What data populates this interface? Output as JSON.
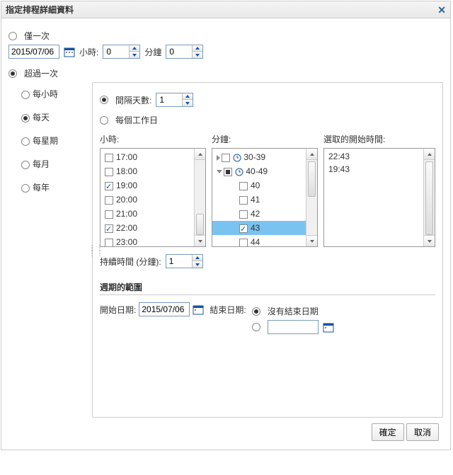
{
  "title": "指定排程詳細資料",
  "once": {
    "label": "僅一次",
    "date": "2015/07/06",
    "hour_label": "小時:",
    "hour_value": "0",
    "minute_label": "分鐘",
    "minute_value": "0"
  },
  "more_than_once": {
    "label": "超過一次",
    "options": {
      "hourly": "每小時",
      "daily": "每天",
      "weekly": "每星期",
      "monthly": "每月",
      "yearly": "每年"
    }
  },
  "interval": {
    "days_label": "間隔天數:",
    "days_value": "1",
    "workday_label": "每個工作日"
  },
  "columns": {
    "hour": "小時:",
    "minute": "分鐘:",
    "selected": "選取的開始時間:"
  },
  "hours": [
    "17:00",
    "18:00",
    "19:00",
    "20:00",
    "21:00",
    "22:00",
    "23:00"
  ],
  "hours_checked": [
    "19:00",
    "22:00"
  ],
  "minute_tree": {
    "group_30_39": "30-39",
    "group_40_49": "40-49",
    "items": [
      "40",
      "41",
      "42",
      "43",
      "44"
    ],
    "checked": [
      "43"
    ]
  },
  "selected_times": [
    "22:43",
    "19:43"
  ],
  "duration": {
    "label": "持續時間 (分鐘):",
    "value": "1"
  },
  "range": {
    "title": "週期的範圍",
    "start_label": "開始日期:",
    "start_date": "2015/07/06",
    "end_label": "結束日期:",
    "no_end_label": "沒有結束日期",
    "end_date_value": ""
  },
  "buttons": {
    "ok": "確定",
    "cancel": "取消"
  }
}
